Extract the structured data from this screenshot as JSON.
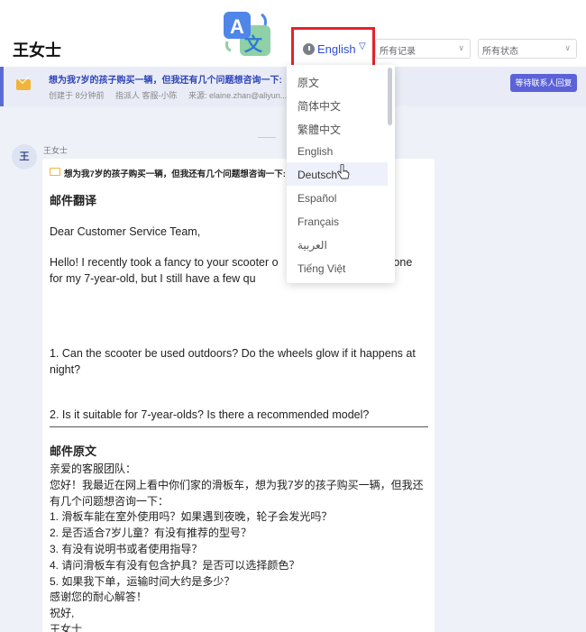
{
  "header": {
    "title": "王女士",
    "language_selected": "English",
    "filter_records": "所有记录",
    "filter_status": "所有状态"
  },
  "banner": {
    "subject": "想为我7岁的孩子购买一辆，但我还有几个问题想咨询一下:",
    "meta": [
      "创建于 8分钟前",
      "指派人 客服-小陈",
      "来源: elaine.zhan@aliyun..."
    ],
    "button": "等待联系人回复"
  },
  "message": {
    "avatar": "王",
    "sender": "王女士",
    "subject": "想为我7岁的孩子购买一辆，但我还有几个问题想咨询一下:",
    "translation_title": "邮件翻译",
    "greeting": "Dear Customer Service Team,",
    "paragraph": "Hello! I recently took a fancy to your scooter o                          to buy one for my 7-year-old, but I still have a few qu                         to consult:",
    "q1": "1. Can the scooter be used outdoors? Do the wheels glow if it happens at night?",
    "q2": "2. Is it suitable for 7-year-olds? Is there a recommended model?",
    "original_title": "邮件原文",
    "original_lines": [
      "亲爱的客服团队：",
      "您好！我最近在网上看中你们家的滑板车，想为我7岁的孩子购买一辆，但我还",
      "有几个问题想咨询一下：",
      "1.   滑板车能在室外使用吗？如果遇到夜晚，轮子会发光吗？",
      "2.   是否适合7岁儿童？有没有推荐的型号？",
      "3.   有没有说明书或者使用指导？",
      "4.   请问滑板车有没有包含护具？是否可以选择颜色？",
      "5.   如果我下单，运输时间大约是多少？",
      "感谢您的耐心解答！",
      "祝好,",
      "王女士"
    ]
  },
  "dropdown": {
    "items": [
      "原文",
      "简体中文",
      "繁體中文",
      "English",
      "Deutsch",
      "Español",
      "Français",
      "العربية",
      "Tiếng Việt"
    ],
    "hovered": "Deutsch"
  },
  "colors": {
    "accent": "#2f4fd6",
    "highlight_border": "#e2242a",
    "button_bg": "#5b62d8",
    "envelope": "#f0b43c"
  }
}
